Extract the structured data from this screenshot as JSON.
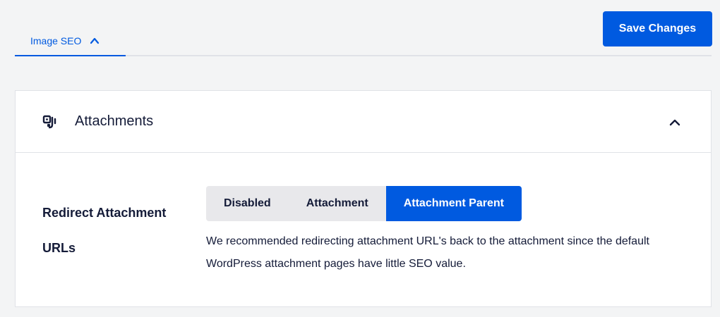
{
  "tabs": [
    {
      "label": "Image SEO",
      "active": true
    }
  ],
  "toolbar": {
    "save_label": "Save Changes"
  },
  "card": {
    "title": "Attachments",
    "icon": "attachment-icon",
    "collapsed": false
  },
  "setting": {
    "label": "Redirect Attachment URLs",
    "options": [
      "Disabled",
      "Attachment",
      "Attachment Parent"
    ],
    "selected": "Attachment Parent",
    "description": "We recommended redirecting attachment URL's back to the attachment since the default WordPress attachment pages have little SEO value."
  },
  "colors": {
    "accent": "#005ae0",
    "background": "#f3f4f5",
    "text": "#141b38",
    "segment_inactive": "#e8e8eb"
  }
}
